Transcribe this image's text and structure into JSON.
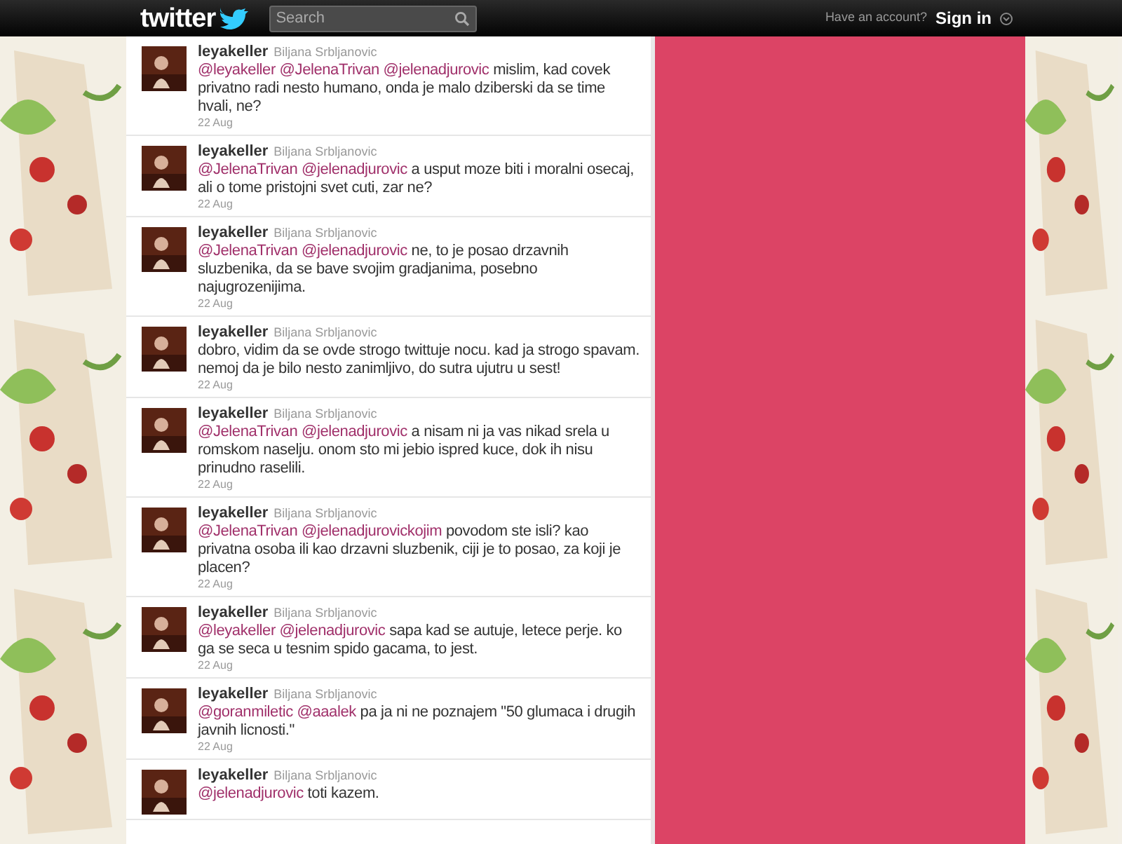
{
  "topbar": {
    "logo": "twitter",
    "search": {
      "placeholder": "Search"
    },
    "account_prompt": "Have an account?",
    "sign_in": "Sign in"
  },
  "tweets": [
    {
      "username": "leyakeller",
      "full_name": "Biljana Srbljanovic",
      "mentions": [
        "@leyakeller",
        "@JelenaTrivan",
        "@jelenadjurovic"
      ],
      "text": "mislim, kad covek privatno radi nesto humano, onda je malo dziberski da se time hvali, ne?",
      "date": "22 Aug"
    },
    {
      "username": "leyakeller",
      "full_name": "Biljana Srbljanovic",
      "mentions": [
        "@JelenaTrivan",
        "@jelenadjurovic"
      ],
      "text": "a usput moze biti i moralni osecaj, ali o tome pristojni svet cuti, zar ne?",
      "date": "22 Aug"
    },
    {
      "username": "leyakeller",
      "full_name": "Biljana Srbljanovic",
      "mentions": [
        "@JelenaTrivan",
        "@jelenadjurovic"
      ],
      "text": "ne, to je posao drzavnih sluzbenika, da se bave svojim gradjanima, posebno najugrozenijima.",
      "date": "22 Aug"
    },
    {
      "username": "leyakeller",
      "full_name": "Biljana Srbljanovic",
      "text": "dobro, vidim da se ovde strogo twittuje nocu. kad ja strogo spavam. nemoj da je bilo nesto zanimljivo, do sutra ujutru u sest!",
      "date": "22 Aug"
    },
    {
      "username": "leyakeller",
      "full_name": "Biljana Srbljanovic",
      "mentions": [
        "@JelenaTrivan",
        "@jelenadjurovic"
      ],
      "text": "a nisam ni ja vas nikad srela u romskom naselju. onom sto mi jebio ispred kuce, dok ih nisu prinudno raselili.",
      "date": "22 Aug"
    },
    {
      "username": "leyakeller",
      "full_name": "Biljana Srbljanovic",
      "mentions": [
        "@JelenaTrivan",
        "@jelenadjurovickojim"
      ],
      "text": "povodom ste isli? kao privatna osoba ili kao drzavni sluzbenik, ciji je to posao, za koji je placen?",
      "date": "22 Aug"
    },
    {
      "username": "leyakeller",
      "full_name": "Biljana Srbljanovic",
      "mentions": [
        "@leyakeller",
        "@jelenadjurovic"
      ],
      "text": "sapa kad se autuje, letece perje. ko ga se seca u tesnim spido gacama, to jest.",
      "date": "22 Aug"
    },
    {
      "username": "leyakeller",
      "full_name": "Biljana Srbljanovic",
      "mentions": [
        "@goranmiletic",
        "@aaalek"
      ],
      "text": "pa ja ni ne poznajem \"50 glumaca i drugih javnih licnosti.\"",
      "date": "22 Aug"
    },
    {
      "username": "leyakeller",
      "full_name": "Biljana Srbljanovic",
      "mentions": [
        "@jelenadjurovic"
      ],
      "text": "toti kazem."
    }
  ]
}
